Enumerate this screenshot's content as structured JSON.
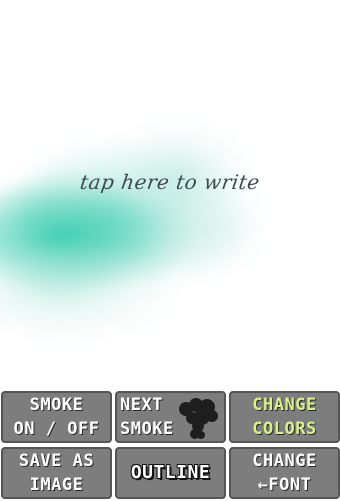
{
  "canvas": {
    "prompt": "tap here to write",
    "smoke_color": "#26c8a8"
  },
  "buttons": {
    "smoke_toggle": {
      "line1": "SMOKE",
      "line2": "ON / OFF"
    },
    "next_smoke": {
      "line1": "NEXT",
      "line2": "SMOKE",
      "icon": "smoke-cloud-icon"
    },
    "change_colors": {
      "line1": "CHANGE",
      "line2": "COLORS",
      "text_color": "#d8f08a"
    },
    "save_image": {
      "line1": "SAVE AS",
      "line2": "IMAGE"
    },
    "outline": {
      "line1": "OUTLINE"
    },
    "change_font": {
      "line1": "CHANGE",
      "line2": "←FONT"
    }
  },
  "colors": {
    "button_bg": "#7d7d7d",
    "button_text": "#ffffff"
  }
}
